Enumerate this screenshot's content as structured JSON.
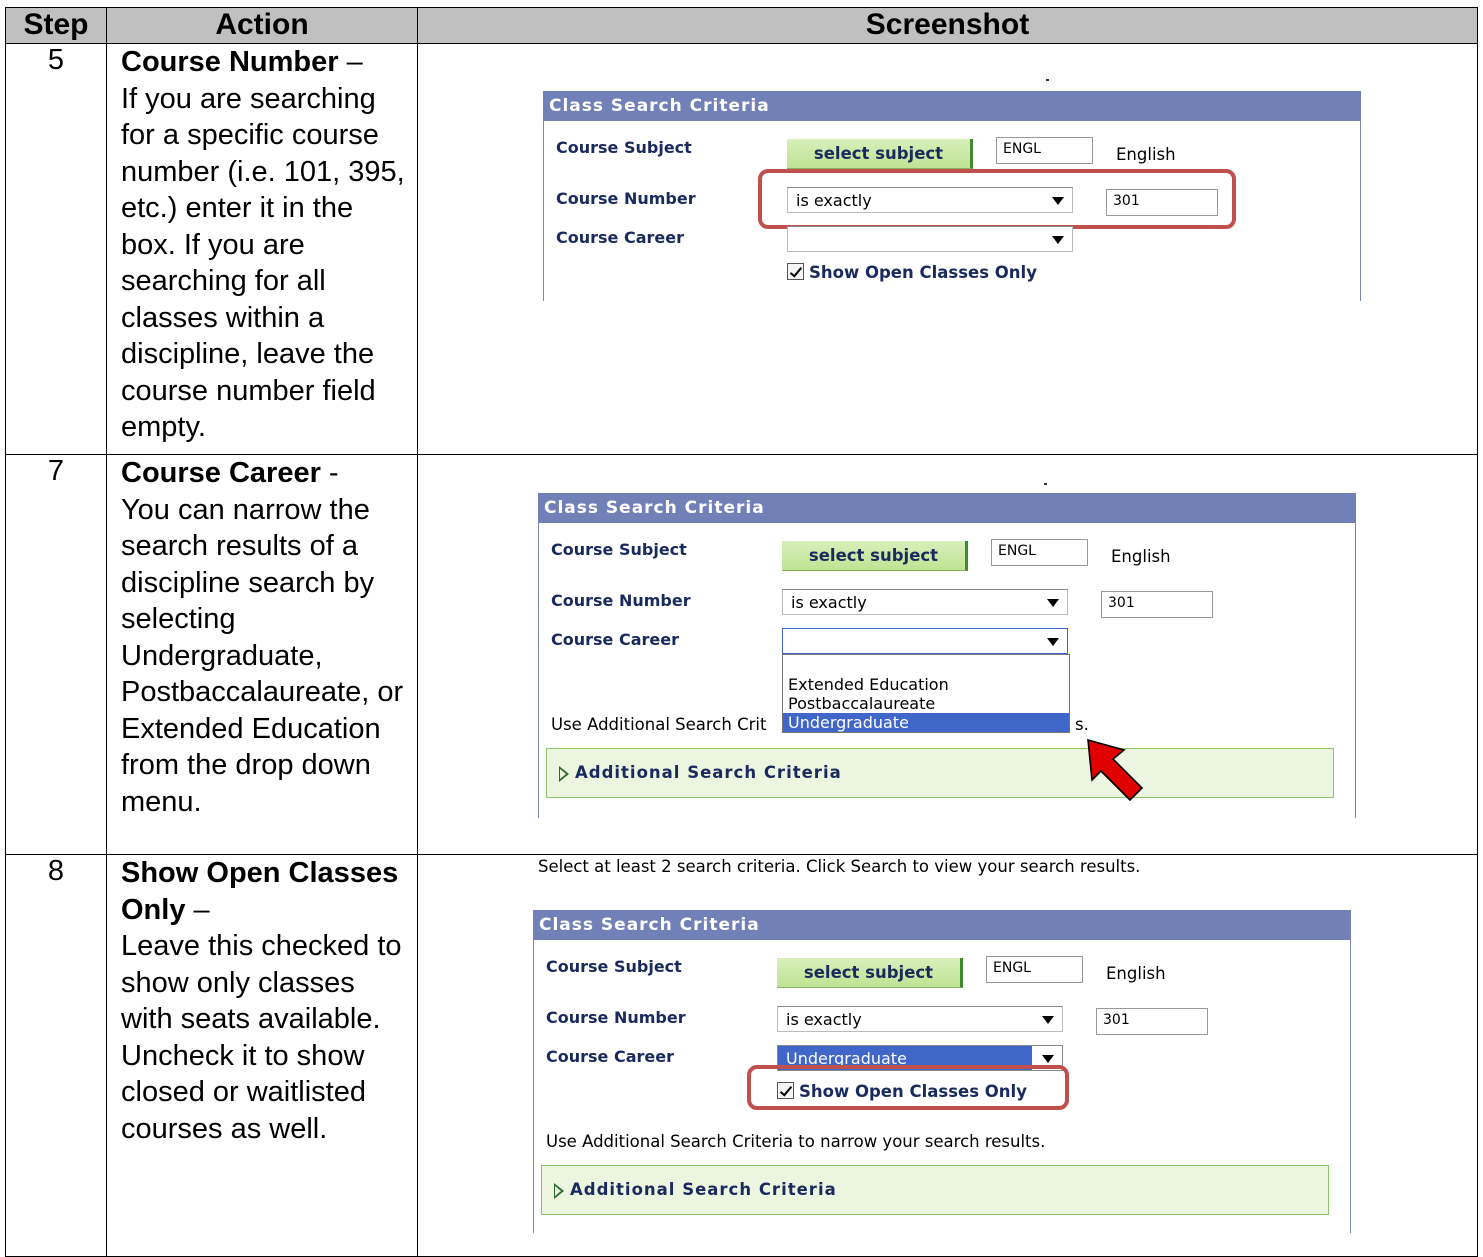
{
  "table": {
    "headers": [
      "Step",
      "Action",
      "Screenshot"
    ]
  },
  "rows": [
    {
      "step": "5",
      "title": "Course Number",
      "sep": " –",
      "body": "If you are searching for a specific course number (i.e. 101, 395, etc.) enter it in the box. If you are searching for all classes within a discipline, leave the course number field empty."
    },
    {
      "step": "7",
      "title": "Course Career",
      "sep": " -",
      "body": "You can narrow the search results of a discipline search by selecting Undergraduate, Postbaccalaureate, or Extended Education from the drop down menu."
    },
    {
      "step": "8",
      "title": "Show Open Classes Only",
      "sep": " –",
      "body": "Leave this checked to show only classes with seats available.  Uncheck it to show closed or waitlisted courses as well."
    }
  ],
  "form": {
    "header": "Class Search Criteria",
    "instructions": "Select at least 2 search criteria. Click Search to view your search results.",
    "course_subject_label": "Course Subject",
    "select_subject_button": "select subject",
    "subject_code": "ENGL",
    "subject_name": "English",
    "course_number_label": "Course Number",
    "match_option": "is exactly",
    "course_number_value": "301",
    "course_career_label": "Course Career",
    "career_selected": "Undergraduate",
    "career_options": [
      "Extended Education",
      "Postbaccalaureate",
      "Undergraduate"
    ],
    "show_open_label": "Show Open Classes Only",
    "show_open_checked": true,
    "additional_hint": "Use Additional Search Criteria to narrow your search results.",
    "additional_hint_visible_start": "Use Additional Search Crit",
    "additional_hint_visible_end": "s.",
    "additional_link": "Additional Search Criteria"
  },
  "colors": {
    "header_bg": "#7180b7",
    "highlight_border": "#c0504d",
    "arrow_fill": "#e00000",
    "button_green": "#bfe393",
    "selected_blue": "#3f66c8"
  }
}
